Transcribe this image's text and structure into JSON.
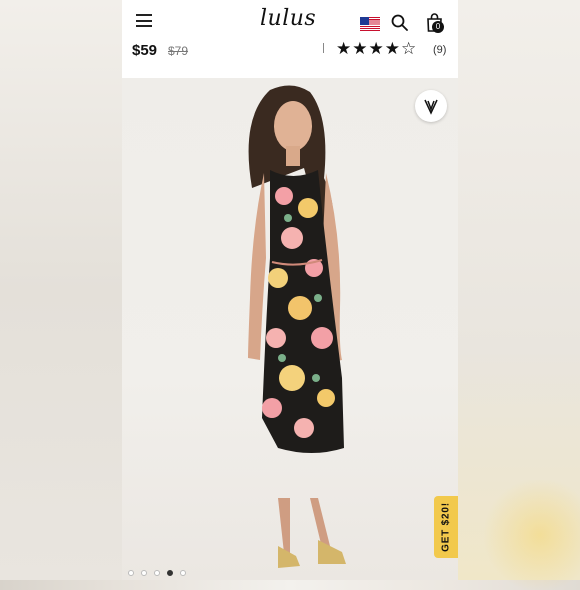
{
  "header": {
    "logo_text": "lulus",
    "cart_count": "0",
    "icons": [
      "menu-icon",
      "us-flag-icon",
      "search-icon",
      "shopping-bag-icon"
    ]
  },
  "product": {
    "price": "$59",
    "original_price": "$79",
    "rating": 4.5,
    "rating_max": 5,
    "stars_display": "★★★★☆",
    "review_count": "(9)"
  },
  "gallery": {
    "image_count": 5,
    "active_index": 3,
    "promo_tab": "GET $20!",
    "favorite_icon": "heart-icon"
  },
  "colors": {
    "promo": "#f2c94c",
    "text": "#111111",
    "strike": "#777777"
  }
}
